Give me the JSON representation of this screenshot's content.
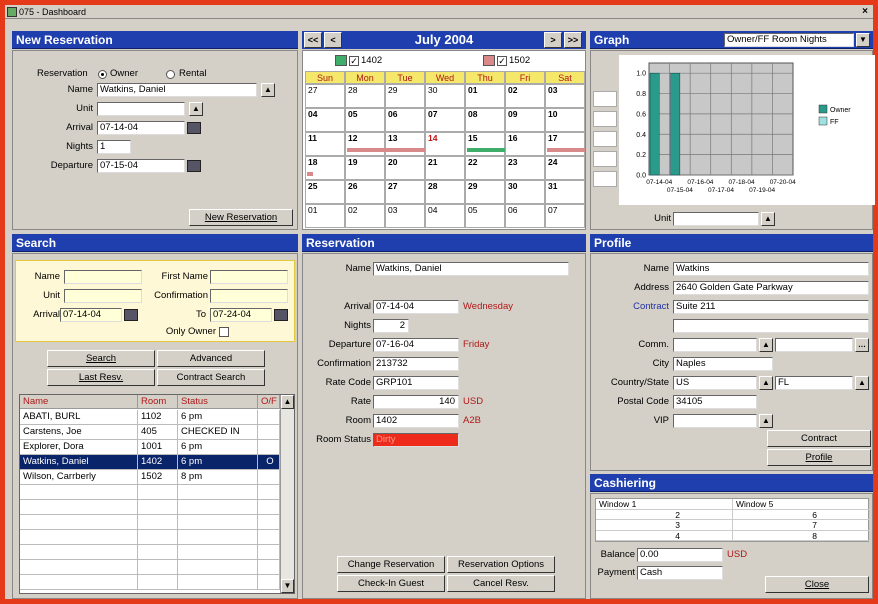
{
  "window": {
    "title": "075 - Dashboard",
    "close": "×"
  },
  "new_res": {
    "header": "New Reservation",
    "reservation_label": "Reservation",
    "owner_label": "Owner",
    "rental_label": "Rental",
    "name_label": "Name",
    "name_value": "Watkins, Daniel",
    "unit_label": "Unit",
    "unit_value": "",
    "arrival_label": "Arrival",
    "arrival_value": "07-14-04",
    "nights_label": "Nights",
    "nights_value": "1",
    "departure_label": "Departure",
    "departure_value": "07-15-04",
    "button": "New Reservation"
  },
  "calendar": {
    "prev_year": "<<",
    "prev": "<",
    "month": "July 2004",
    "next": ">",
    "next_year": ">>",
    "legend": [
      {
        "label": "1402",
        "color": "#3fae6a"
      },
      {
        "label": "1502",
        "color": "#d88a8a"
      }
    ],
    "days_of_week": [
      "Sun",
      "Mon",
      "Tue",
      "Wed",
      "Thu",
      "Fri",
      "Sat"
    ],
    "weeks": [
      [
        "27",
        "28",
        "29",
        "30",
        "01",
        "02",
        "03"
      ],
      [
        "04",
        "05",
        "06",
        "07",
        "08",
        "09",
        "10"
      ],
      [
        "11",
        "12",
        "13",
        "14",
        "15",
        "16",
        "17"
      ],
      [
        "18",
        "19",
        "20",
        "21",
        "22",
        "23",
        "24"
      ],
      [
        "25",
        "26",
        "27",
        "28",
        "29",
        "30",
        "31"
      ],
      [
        "01",
        "02",
        "03",
        "04",
        "05",
        "06",
        "07"
      ]
    ]
  },
  "graph": {
    "header": "Graph",
    "select": "Owner/FF Room Nights",
    "unit_label": "Unit",
    "unit_value": ""
  },
  "chart_data": {
    "type": "bar",
    "categories": [
      "07-14-04",
      "07-15-04",
      "07-16-04",
      "07-17-04",
      "07-18-04",
      "07-19-04",
      "07-20-04"
    ],
    "series": [
      {
        "name": "Owner",
        "values": [
          1,
          1,
          0,
          0,
          0,
          0,
          0
        ],
        "color": "#2a9a8a"
      },
      {
        "name": "FF",
        "values": [
          0,
          0,
          0,
          0,
          0,
          0,
          0
        ],
        "color": "#9fe0e0"
      }
    ],
    "yticks": [
      "0.0",
      "0.2",
      "0.4",
      "0.6",
      "0.8",
      "1.0"
    ],
    "ylim": [
      0,
      1.1
    ],
    "grid": true,
    "legend": "right"
  },
  "search": {
    "header": "Search",
    "name_label": "Name",
    "name_value": "",
    "first_label": "First Name",
    "first_value": "",
    "unit_label": "Unit",
    "unit_value": "",
    "conf_label": "Confirmation",
    "conf_value": "",
    "arrival_label": "Arrival",
    "arrival_value": "07-14-04",
    "to_label": "To",
    "to_value": "07-24-04",
    "only_owner_label": "Only Owner",
    "btn_search": "Search",
    "btn_advanced": "Advanced",
    "btn_last": "Last Resv.",
    "btn_contract": "Contract Search",
    "columns": [
      "Name",
      "Room",
      "Status",
      "O/F"
    ],
    "rows": [
      [
        "ABATI, BURL",
        "1102",
        "6 pm",
        ""
      ],
      [
        "Carstens, Joe",
        "405",
        "CHECKED IN",
        ""
      ],
      [
        "Explorer, Dora",
        "1001",
        "6 pm",
        ""
      ],
      [
        "Watkins, Daniel",
        "1402",
        "6 pm",
        "O"
      ],
      [
        "Wilson, Carrberly",
        "1502",
        "8 pm",
        ""
      ]
    ]
  },
  "reservation": {
    "header": "Reservation",
    "name_label": "Name",
    "name_value": "Watkins, Daniel",
    "arrival_label": "Arrival",
    "arrival_value": "07-14-04",
    "arrival_day": "Wednesday",
    "nights_label": "Nights",
    "nights_value": "2",
    "departure_label": "Departure",
    "departure_value": "07-16-04",
    "departure_day": "Friday",
    "conf_label": "Confirmation",
    "conf_value": "213732",
    "rate_code_label": "Rate Code",
    "rate_code_value": "GRP101",
    "rate_label": "Rate",
    "rate_value": "140",
    "rate_currency": "USD",
    "room_label": "Room",
    "room_value": "1402",
    "room_type": "A2B",
    "status_label": "Room Status",
    "status_value": "Dirty",
    "btn_change": "Change Reservation",
    "btn_options": "Reservation Options",
    "btn_checkin": "Check-In Guest",
    "btn_cancel": "Cancel Resv."
  },
  "profile": {
    "header": "Profile",
    "name_label": "Name",
    "name_value": "Watkins",
    "address_label": "Address",
    "address_value": "2640 Golden Gate Parkway",
    "contract_label": "Contract",
    "contract_value": "Suite 211",
    "line2_value": "",
    "comm_label": "Comm.",
    "comm_value": "",
    "city_label": "City",
    "city_value": "Naples",
    "country_label": "Country/State",
    "country_value": "US",
    "state_value": "FL",
    "postal_label": "Postal Code",
    "postal_value": "34105",
    "vip_label": "VIP",
    "vip_value": "",
    "btn_contract": "Contract",
    "btn_profile": "Profile"
  },
  "cashiering": {
    "header": "Cashiering",
    "rows": [
      [
        "Window 1",
        "Window 5"
      ],
      [
        "2",
        "6"
      ],
      [
        "3",
        "7"
      ],
      [
        "4",
        "8"
      ]
    ],
    "balance_label": "Balance",
    "balance_value": "0.00",
    "balance_currency": "USD",
    "payment_label": "Payment",
    "payment_value": "Cash",
    "btn_close": "Close"
  }
}
